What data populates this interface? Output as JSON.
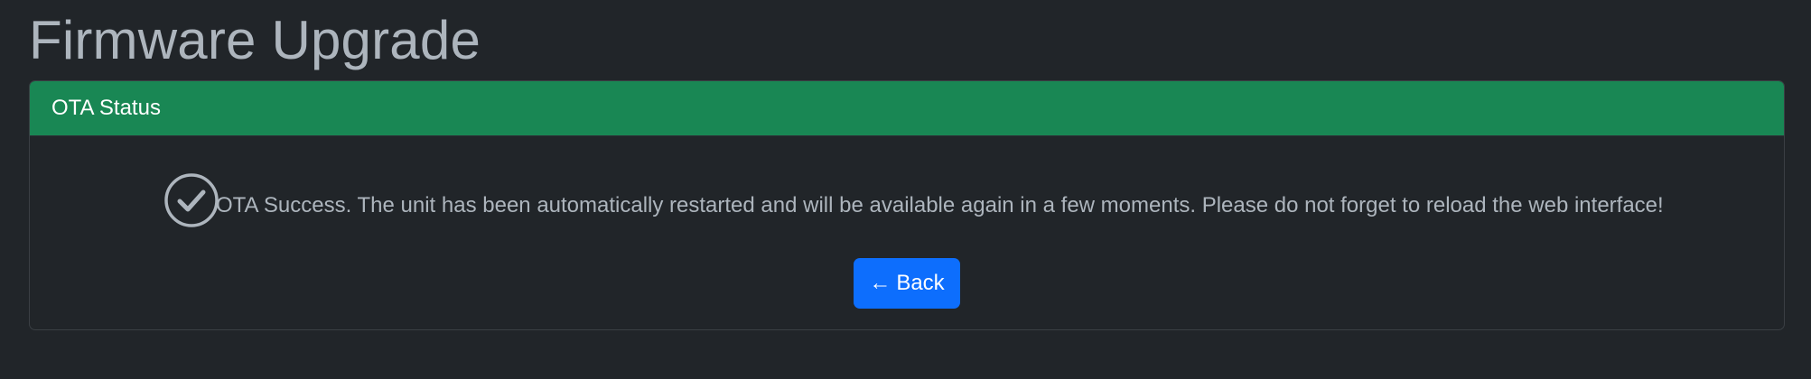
{
  "page": {
    "title": "Firmware Upgrade"
  },
  "card": {
    "header": "OTA Status",
    "status_icon": "check-circle-icon",
    "message": "OTA Success. The unit has been automatically restarted and will be available again in a few moments. Please do not forget to reload the web interface!",
    "back_button": {
      "arrow": "←",
      "label": "Back"
    }
  },
  "colors": {
    "background": "#212529",
    "header_bg": "#198754",
    "button_bg": "#0d6efd",
    "text": "#adb5bd"
  }
}
